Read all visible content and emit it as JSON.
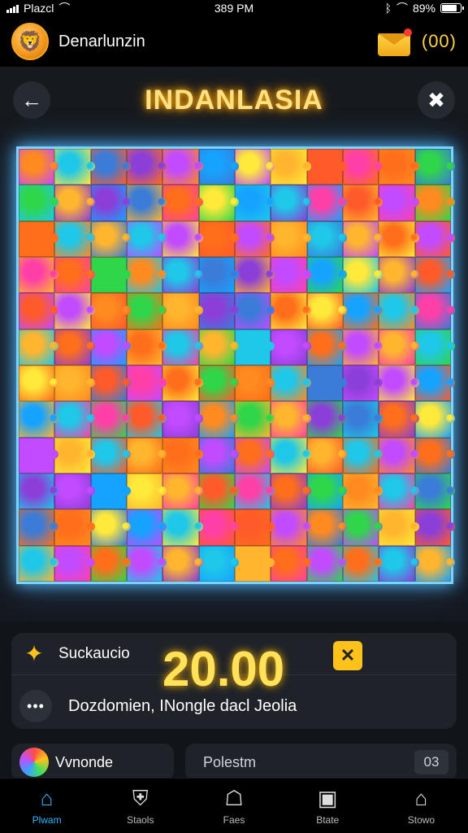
{
  "status_bar": {
    "carrier": "Plazcl",
    "time": "389 PM",
    "battery": "89%"
  },
  "header": {
    "username": "Denarlunzin",
    "counter": "(00)"
  },
  "title": "INDANLASIA",
  "score": {
    "label": "Suckaucio",
    "value": "20.00"
  },
  "hint": "Dozdomien, INongle dacl Jeolia",
  "cards": {
    "left_label": "Vvnonde",
    "right_label": "Polestm",
    "right_badge": "03"
  },
  "tabs": [
    {
      "label": "Plwam"
    },
    {
      "label": "Staols"
    },
    {
      "label": "Faes"
    },
    {
      "label": "Btate"
    },
    {
      "label": "Stowo"
    }
  ],
  "icons": {
    "back": "arrow-left-icon",
    "settings": "runner-icon",
    "mail": "envelope-icon",
    "score": "star-icon",
    "close": "x-icon",
    "more": "dots-icon",
    "flower": "flower-icon"
  },
  "colors": {
    "accent": "#39b4ff",
    "gold": "#ffc21a",
    "frame": "#79d3ff",
    "puzzle": [
      "#ff8a1f",
      "#ffb52e",
      "#3a7cd8",
      "#ff3fa8",
      "#c24bff",
      "#2fd64a",
      "#ffe93a",
      "#1fc7e8",
      "#ff5a2a",
      "#8b3fd8",
      "#ff6e1a",
      "#16a3ff"
    ]
  }
}
